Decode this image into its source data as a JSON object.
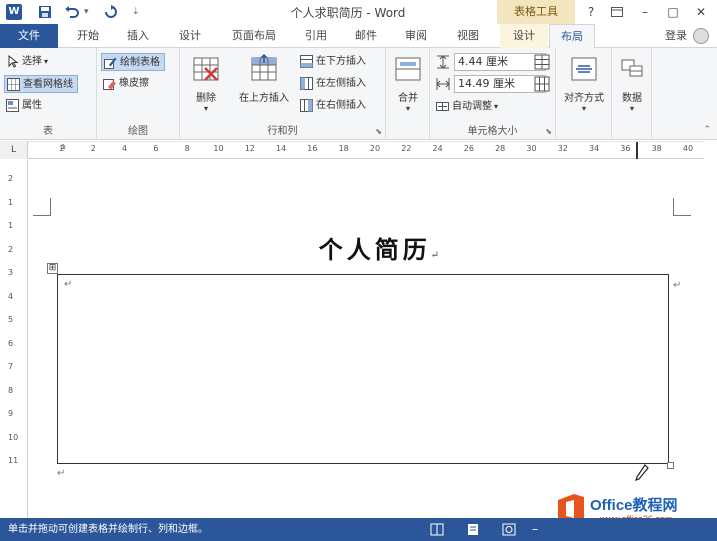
{
  "window": {
    "title": "个人求职简历 - Word",
    "app_icon": "W",
    "context_tools": "表格工具",
    "help": "?",
    "minimize": "–",
    "restore": "□",
    "close": "✕"
  },
  "quick_access": {
    "save_icon": "save-icon",
    "undo_icon": "undo-icon",
    "redo_icon": "redo-icon"
  },
  "tabs": {
    "file": "文件",
    "items": [
      "开始",
      "插入",
      "设计",
      "页面布局",
      "引用",
      "邮件",
      "审阅",
      "视图",
      "设计",
      "布局"
    ],
    "login": "登录"
  },
  "ribbon": {
    "groups": {
      "table": {
        "label": "表",
        "select": "选择",
        "view_gridlines": "查看网格线",
        "properties": "属性"
      },
      "draw": {
        "label": "绘图",
        "draw_table": "绘制表格",
        "eraser": "橡皮擦"
      },
      "rows_cols": {
        "label": "行和列",
        "delete": "删除",
        "insert_above": "在上方插入",
        "insert_below": "在下方插入",
        "insert_left": "在左侧插入",
        "insert_right": "在右侧插入"
      },
      "merge": {
        "label": "合并"
      },
      "cell_size": {
        "label": "单元格大小",
        "height": "4.44 厘米",
        "width": "14.49 厘米",
        "autofit": "自动调整"
      },
      "align": {
        "label": "对齐方式"
      },
      "data": {
        "label": "数据"
      }
    }
  },
  "ruler": {
    "corner": "L",
    "h_labels": [
      "2",
      "2",
      "4",
      "6",
      "8",
      "10",
      "12",
      "14",
      "16",
      "18",
      "20",
      "22",
      "24",
      "26",
      "28",
      "30",
      "32",
      "34",
      "36",
      "38",
      "40"
    ],
    "v_labels": [
      "2",
      "1",
      "1",
      "2",
      "3",
      "4",
      "5",
      "6",
      "7",
      "8",
      "9",
      "10",
      "11"
    ]
  },
  "document": {
    "heading": "个人简历",
    "paragraph_mark": "↵",
    "table_move_handle": "⊞"
  },
  "statusbar": {
    "text": "单击并拖动可创建表格并绘制行、列和边框。"
  },
  "watermark": {
    "brand": "Office教程网",
    "url": "www.office26.com"
  }
}
